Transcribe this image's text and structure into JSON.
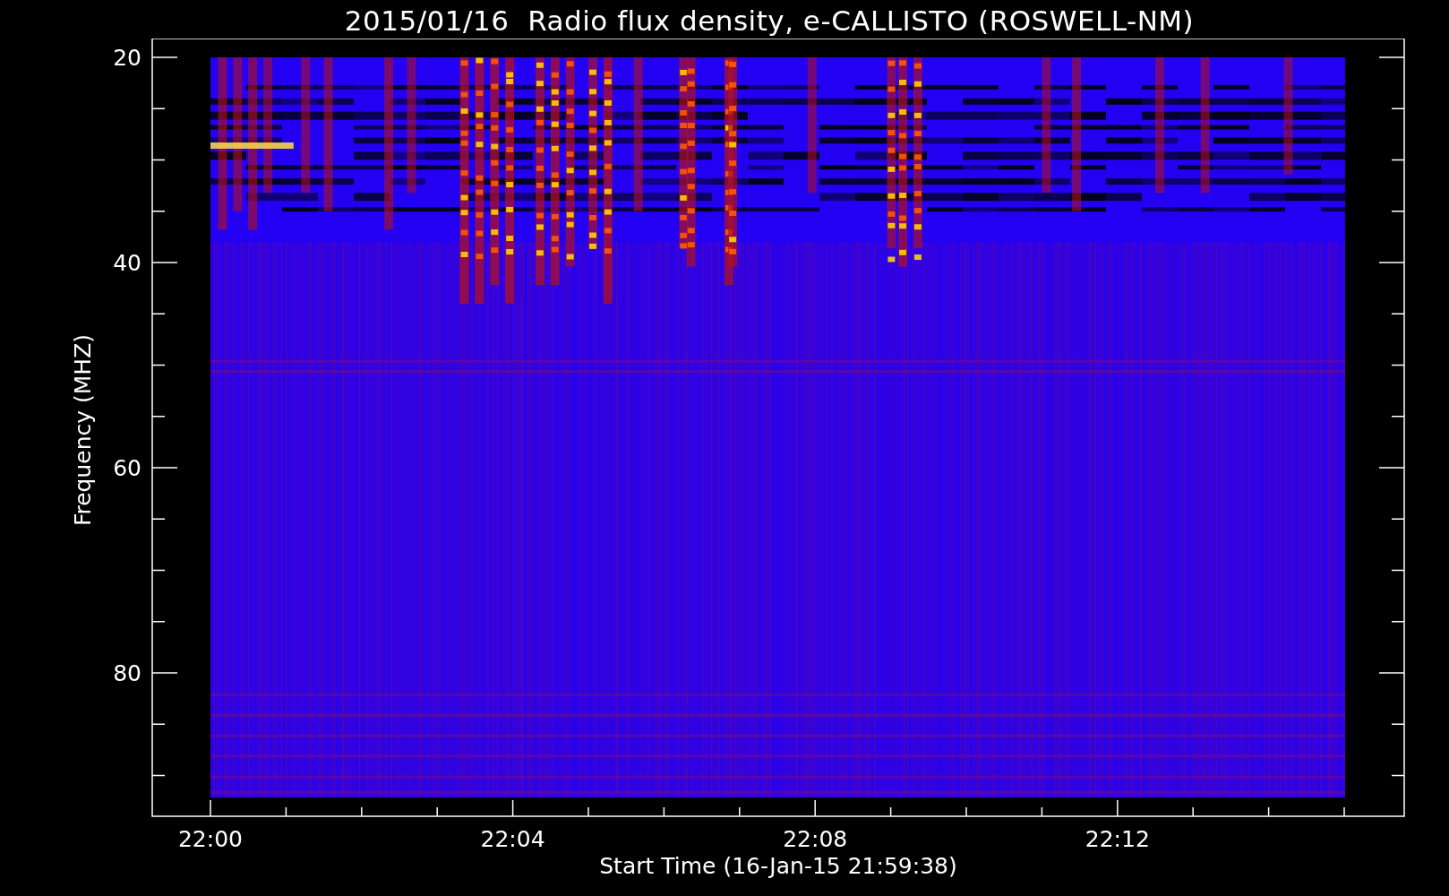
{
  "title": "2015/01/16  Radio flux density, e-CALLISTO (ROSWELL-NM)",
  "y_axis": {
    "label": "Frequency (MHZ)",
    "ticks": [
      "20",
      "40",
      "60",
      "80"
    ]
  },
  "x_axis": {
    "label": "Start Time (16-Jan-15 21:59:38)",
    "ticks": [
      "22:00",
      "22:04",
      "22:08",
      "22:12"
    ]
  }
}
